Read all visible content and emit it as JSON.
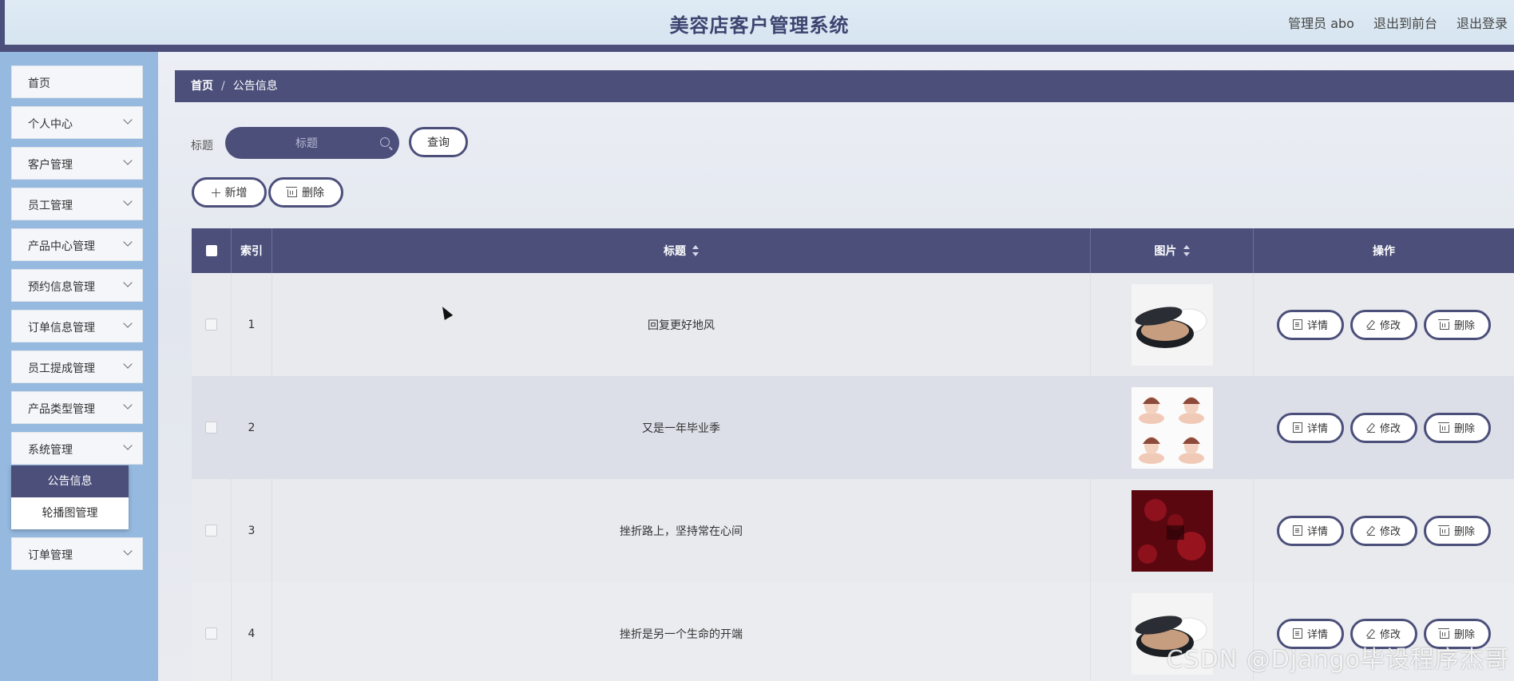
{
  "header": {
    "title": "美容店客户管理系统",
    "user": "管理员 abo",
    "to_front": "退出到前台",
    "logout": "退出登录"
  },
  "sidebar": {
    "items": [
      {
        "label": "首页",
        "expandable": false
      },
      {
        "label": "个人中心",
        "expandable": true
      },
      {
        "label": "客户管理",
        "expandable": true
      },
      {
        "label": "员工管理",
        "expandable": true
      },
      {
        "label": "产品中心管理",
        "expandable": true
      },
      {
        "label": "预约信息管理",
        "expandable": true
      },
      {
        "label": "订单信息管理",
        "expandable": true
      },
      {
        "label": "员工提成管理",
        "expandable": true
      },
      {
        "label": "产品类型管理",
        "expandable": true
      },
      {
        "label": "系统管理",
        "expandable": true
      },
      {
        "label": "订单管理",
        "expandable": true
      }
    ],
    "system_sub": [
      "公告信息",
      "轮播图管理"
    ]
  },
  "breadcrumb": {
    "home": "首页",
    "sep": "/",
    "current": "公告信息"
  },
  "search": {
    "label": "标题",
    "placeholder": "标题",
    "query_button": "查询"
  },
  "actions": {
    "add": "新增",
    "delete": "删除"
  },
  "table": {
    "headers": {
      "index": "索引",
      "title": "标题",
      "image": "图片",
      "ops": "操作"
    },
    "rows": [
      {
        "index": "1",
        "title": "回复更好地风",
        "thumb": "cushion"
      },
      {
        "index": "2",
        "title": "又是一年毕业季",
        "thumb": "faces"
      },
      {
        "index": "3",
        "title": "挫折路上，坚持常在心间",
        "thumb": "red"
      },
      {
        "index": "4",
        "title": "挫折是另一个生命的开端",
        "thumb": "cushion"
      }
    ],
    "op_labels": {
      "detail": "详情",
      "edit": "修改",
      "delete": "删除"
    }
  },
  "watermark": "CSDN @Django毕设程序杰哥",
  "colors": {
    "primary": "#4b4f7a",
    "sidebar": "#95b9df",
    "header": "#d6e5f1"
  }
}
